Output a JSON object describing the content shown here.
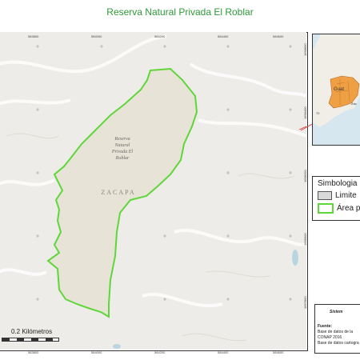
{
  "title": "Reserva Natural Privada El Roblar",
  "map": {
    "reserve_label": "Reserva Natural Privada El Roblar",
    "reserve_label_lines": [
      "Reserva",
      "Natural",
      "Privada El",
      "Roblar"
    ],
    "department_label": "ZACAPA",
    "x_ticks_top": [
      "583800",
      "584000",
      "584200",
      "584400",
      "584600"
    ],
    "x_ticks_bottom": [
      "583800",
      "584000",
      "584200",
      "584400",
      "584600"
    ],
    "y_ticks_right": [
      "1658600",
      "1658400",
      "1658200",
      "1658000",
      "1657800"
    ],
    "area_color": "#5fd63a",
    "reserve_fill": "#e7e3d6",
    "terrain_color": "#eeece8"
  },
  "inset": {
    "partial_label": "Guat",
    "label_fragment_1": "Zac",
    "label_fragment_2": "72"
  },
  "legend": {
    "title": "Simbologia",
    "items": [
      {
        "label": "Limite",
        "type": "limit"
      },
      {
        "label": "Área pr",
        "type": "area"
      }
    ]
  },
  "source_box": {
    "header": "Sistem",
    "fuente_label": "Fuente:",
    "line1": "Base de datos de la",
    "line2": "CONAP 2016",
    "line3": "Base de datos cartogra"
  },
  "scale": {
    "label": "0.2 Kilómetros"
  }
}
